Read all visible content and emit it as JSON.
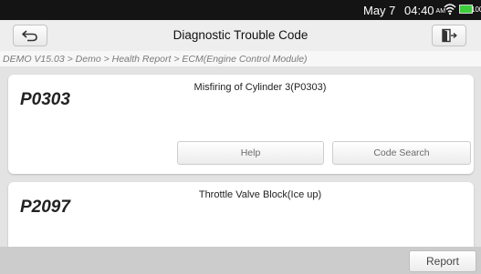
{
  "status_bar": {
    "date": "May 7",
    "time": "04:40",
    "ampm": "AM",
    "battery_text": "100%",
    "battery_color": "#3ccd3c",
    "wifi_icon": "wifi-icon"
  },
  "nav": {
    "title": "Diagnostic Trouble Code",
    "back_icon": "back-arrow-icon",
    "exit_icon": "exit-door-icon"
  },
  "breadcrumb": "DEMO V15.03 > Demo > Health Report > ECM(Engine Control Module)",
  "codes": [
    {
      "code": "P0303",
      "description": "Misfiring of Cylinder 3(P0303)",
      "help_label": "Help",
      "code_search_label": "Code Search"
    },
    {
      "code": "P2097",
      "description": "Throttle Valve Block(Ice up)"
    }
  ],
  "footer": {
    "report_label": "Report"
  },
  "colors": {
    "status_bar_bg": "#141414",
    "content_bg": "#e3e3e3",
    "footer_bg": "#cccccc",
    "card_bg": "#ffffff"
  }
}
